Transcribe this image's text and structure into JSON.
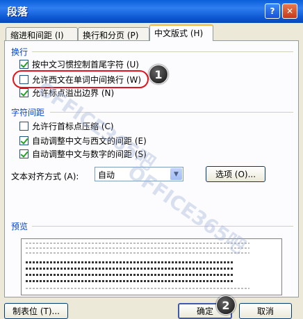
{
  "window": {
    "title": "段落",
    "help_glyph": "?",
    "close_glyph": "✕"
  },
  "tabs": [
    {
      "label": "缩进和间距 (I)"
    },
    {
      "label": "换行和分页 (P)"
    },
    {
      "label": "中文版式 (H)"
    }
  ],
  "sections": {
    "line_break": {
      "title": "换行",
      "options": [
        {
          "label": "按中文习惯控制首尾字符 (U)",
          "checked": true
        },
        {
          "label": "允许西文在单词中间换行 (W)",
          "checked": false
        },
        {
          "label": "允许标点溢出边界 (N)",
          "checked": true
        }
      ]
    },
    "char_spacing": {
      "title": "字符间距",
      "options": [
        {
          "label": "允许行首标点压缩 (C)",
          "checked": false
        },
        {
          "label": "自动调整中文与西文的间距 (E)",
          "checked": true
        },
        {
          "label": "自动调整中文与数字的间距 (S)",
          "checked": true
        }
      ]
    }
  },
  "text_alignment": {
    "label": "文本对齐方式 (A):",
    "value": "自动"
  },
  "options_button": "选项 (O)...",
  "preview": {
    "title": "预览"
  },
  "footer": {
    "tabs_button": "制表位 (T)...",
    "ok_button": "确定",
    "cancel_button": "取消"
  },
  "callouts": [
    "1",
    "2"
  ],
  "watermark": "OFFICE365吧",
  "colors": {
    "title_bar": "#0a5fd8",
    "group_title": "#0046d5",
    "highlight": "#e0141c"
  }
}
